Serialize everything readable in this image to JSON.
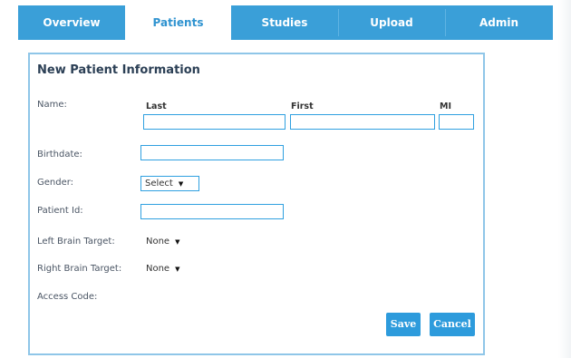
{
  "tabs": [
    {
      "label": "Overview",
      "active": false
    },
    {
      "label": "Patients",
      "active": true
    },
    {
      "label": "Studies",
      "active": false
    },
    {
      "label": "Upload",
      "active": false
    },
    {
      "label": "Admin",
      "active": false
    }
  ],
  "form": {
    "title": "New Patient Information",
    "name_label": "Name:",
    "last_label": "Last",
    "first_label": "First",
    "mi_label": "MI",
    "last_value": "",
    "first_value": "",
    "mi_value": "",
    "birthdate_label": "Birthdate:",
    "birthdate_value": "",
    "gender_label": "Gender:",
    "gender_value": "Select",
    "patient_id_label": "Patient Id:",
    "patient_id_value": "",
    "left_target_label": "Left Brain Target:",
    "left_target_value": "None",
    "right_target_label": "Right Brain Target:",
    "right_target_value": "None",
    "access_code_label": "Access Code:",
    "save_label": "Save",
    "cancel_label": "Cancel"
  },
  "colors": {
    "accent": "#3a9fd8",
    "input_border": "#2fa0e0",
    "title_text": "#2b3f55"
  }
}
